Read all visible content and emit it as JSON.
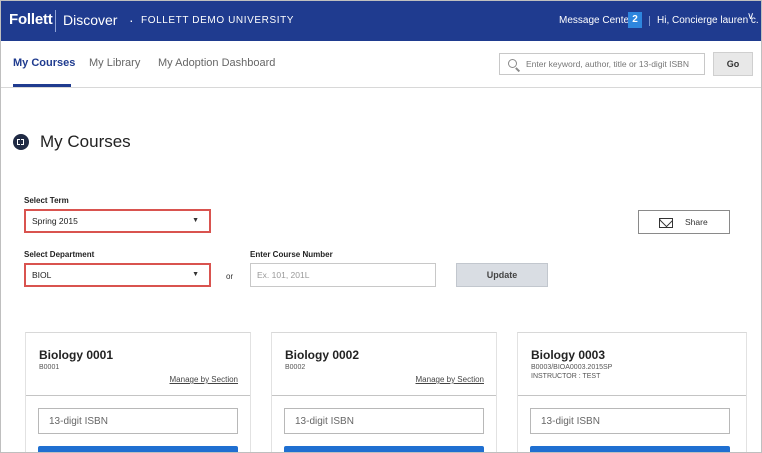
{
  "header": {
    "logo": "Follett",
    "product": "Discover",
    "separator_dot": "·",
    "university": "FOLLETT DEMO UNIVERSITY",
    "message_center_label": "Message Center",
    "message_count": "2",
    "greeting": "Hi, Concierge lauren c.",
    "chevron": "∨",
    "bg_color": "#1f3b8f"
  },
  "nav": {
    "tabs": [
      {
        "label": "My Courses",
        "active": true
      },
      {
        "label": "My Library",
        "active": false
      },
      {
        "label": "My Adoption Dashboard",
        "active": false
      }
    ],
    "search_placeholder": "Enter keyword, author, title or 13-digit ISBN",
    "go_label": "Go"
  },
  "page": {
    "title": "My Courses",
    "select_term_label": "Select Term",
    "term_value": "Spring 2015",
    "select_department_label": "Select Department",
    "department_value": "BIOL",
    "or_label": "or",
    "course_number_label": "Enter Course Number",
    "course_number_placeholder": "Ex. 101, 201L",
    "update_label": "Update",
    "share_label": "Share",
    "caret": "▼",
    "highlight_color": "#d9534f"
  },
  "courses": [
    {
      "title": "Biology 0001",
      "code": "B0001",
      "instructor": "",
      "link": "Manage by Section",
      "isbn_placeholder": "13-digit ISBN"
    },
    {
      "title": "Biology 0002",
      "code": "B0002",
      "instructor": "",
      "link": "Manage by Section",
      "isbn_placeholder": "13-digit ISBN"
    },
    {
      "title": "Biology 0003",
      "code": "B0003/BIOA0003.2015SP",
      "instructor": "INSTRUCTOR : TEST",
      "link": "",
      "isbn_placeholder": "13-digit ISBN"
    }
  ]
}
